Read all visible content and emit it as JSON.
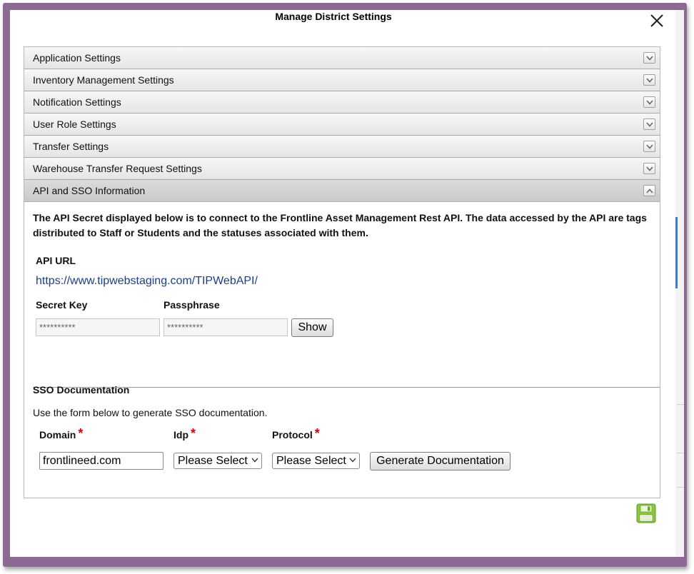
{
  "dialog": {
    "title": "Manage District Settings"
  },
  "accordion": {
    "sections": [
      {
        "label": "Application Settings"
      },
      {
        "label": "Inventory Management Settings"
      },
      {
        "label": "Notification Settings"
      },
      {
        "label": "User Role Settings"
      },
      {
        "label": "Transfer Settings"
      },
      {
        "label": "Warehouse Transfer Request Settings"
      },
      {
        "label": "API and SSO Information"
      }
    ]
  },
  "api": {
    "intro": "The API Secret displayed below is to connect to the Frontline Asset Management Rest API. The data accessed by the API are tags distributed to Staff or Students and the statuses associated with them.",
    "url_label": "API URL",
    "url": "https://www.tipwebstaging.com/TIPWebAPI/",
    "secret_label": "Secret Key",
    "secret_value": "**********",
    "passphrase_label": "Passphrase",
    "passphrase_value": "**********",
    "show_button": "Show"
  },
  "sso": {
    "heading": "SSO Documentation",
    "helper": "Use the form below to generate SSO documentation.",
    "domain_label": "Domain",
    "domain_value": "frontlineed.com",
    "idp_label": "Idp",
    "idp_value": "Please Select",
    "protocol_label": "Protocol",
    "protocol_value": "Please Select",
    "required_mark": "*",
    "generate_button": "Generate Documentation"
  },
  "colors": {
    "frame": "#8c6a94",
    "link": "#1a3e8c",
    "required": "#e00000",
    "save_icon": "#8cc63f"
  }
}
